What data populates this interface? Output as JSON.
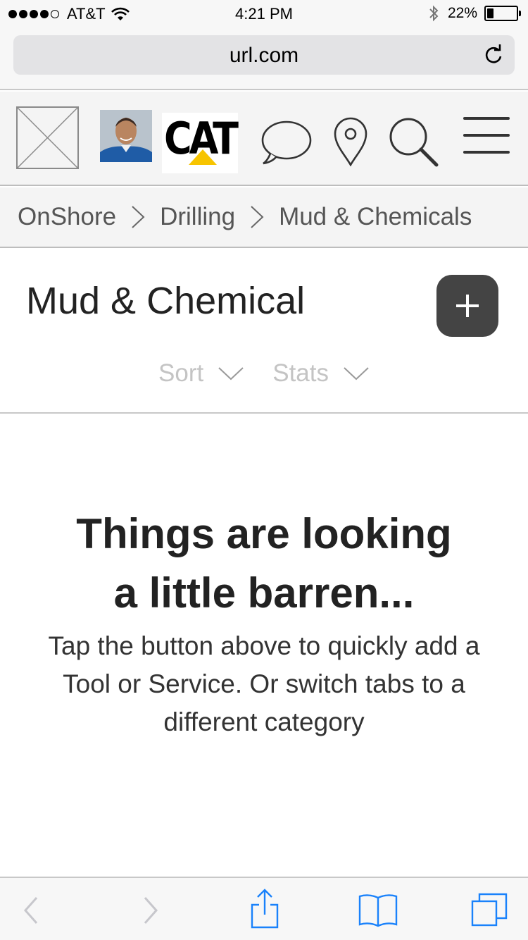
{
  "status_bar": {
    "carrier": "AT&T",
    "time": "4:21 PM",
    "battery_percent": "22%",
    "battery_level": 0.22
  },
  "browser": {
    "url": "url.com"
  },
  "header": {
    "brand_logo_text": "CAT",
    "icons": [
      "logo-placeholder",
      "avatar",
      "cat-logo",
      "chat-icon",
      "location-pin-icon",
      "search-icon",
      "menu-icon"
    ]
  },
  "breadcrumb": {
    "items": [
      "OnShore",
      "Drilling",
      "Mud & Chemicals"
    ]
  },
  "page": {
    "title": "Mud & Chemical",
    "add_button_icon": "plus-icon",
    "filters": [
      {
        "label": "Sort"
      },
      {
        "label": "Stats"
      }
    ]
  },
  "empty_state": {
    "title_line1": "Things are looking",
    "title_line2": "a little barren...",
    "description": "Tap the button above to quickly add a Tool or Service. Or switch tabs to a different category"
  },
  "toolbar": {
    "icons": [
      "back-icon",
      "forward-icon",
      "share-icon",
      "bookmarks-icon",
      "tabs-icon"
    ]
  },
  "colors": {
    "toolbar_blue": "#1a82fb",
    "add_button": "#444444",
    "cat_yellow": "#f7c400"
  }
}
